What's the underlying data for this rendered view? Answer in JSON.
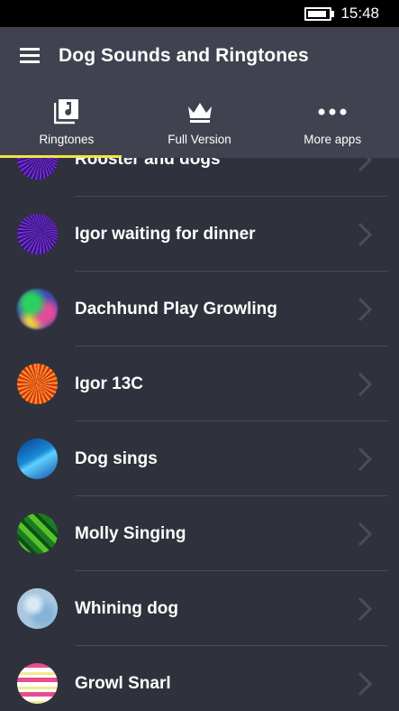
{
  "status_bar": {
    "time": "15:48",
    "battery_level": 0.9
  },
  "app": {
    "title": "Dog Sounds and Ringtones"
  },
  "tabs": [
    {
      "label": "Ringtones",
      "icon": "music-note-icon",
      "active": true
    },
    {
      "label": "Full Version",
      "icon": "crown-icon",
      "active": false
    },
    {
      "label": "More apps",
      "icon": "more-dots-icon",
      "active": false
    }
  ],
  "accent_color": "#f1e447",
  "list": {
    "items": [
      {
        "label": "Rooster and dogs",
        "thumb": "purple-rays"
      },
      {
        "label": "Igor waiting for dinner",
        "thumb": "purple-rays"
      },
      {
        "label": "Dachhund Play Growling",
        "thumb": "colorful-blur"
      },
      {
        "label": "Igor 13C",
        "thumb": "sunburst"
      },
      {
        "label": "Dog sings",
        "thumb": "blue-wave"
      },
      {
        "label": "Molly Singing",
        "thumb": "green-diamonds"
      },
      {
        "label": "Whining dog",
        "thumb": "ice-blue"
      },
      {
        "label": "Growl Snarl",
        "thumb": "pink-stripes"
      }
    ]
  }
}
